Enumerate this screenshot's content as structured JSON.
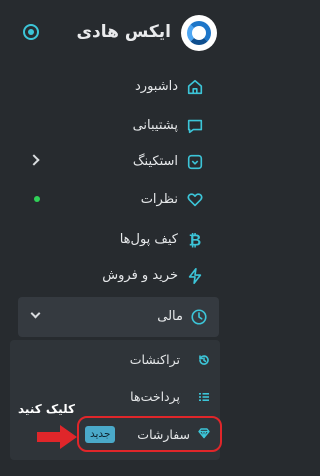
{
  "header": {
    "title": "ایکس هادی",
    "logo_icon": "circle-logo-icon",
    "toggle_icon": "radio-toggle-icon"
  },
  "menu": [
    {
      "label": "داشبورد",
      "icon": "home-icon"
    },
    {
      "label": "پشتیبانی",
      "icon": "chat-icon"
    },
    {
      "label": "استکینگ",
      "icon": "shield-icon",
      "has_submenu": true
    },
    {
      "label": "نظرات",
      "icon": "heart-icon",
      "has_indicator": true
    },
    {
      "label": "کیف پول‌ها",
      "icon": "bitcoin-icon"
    },
    {
      "label": "خرید و فروش",
      "icon": "bolt-icon"
    }
  ],
  "finance": {
    "label": "مالی",
    "icon": "clock-icon",
    "expanded": true,
    "submenu": [
      {
        "label": "تراکنشات",
        "icon": "history-icon"
      },
      {
        "label": "پرداخت‌ها",
        "icon": "list-icon"
      },
      {
        "label": "سفارشات",
        "icon": "gem-icon",
        "badge": "جدید"
      }
    ]
  },
  "annotation": {
    "text": "کلیک کنید",
    "arrow_color": "#e0262a",
    "highlight_color": "#e0262a"
  },
  "colors": {
    "background": "#272b2f",
    "accent": "#3cc5d8",
    "indicator": "#30d158",
    "badge": "#4aa9c9"
  }
}
